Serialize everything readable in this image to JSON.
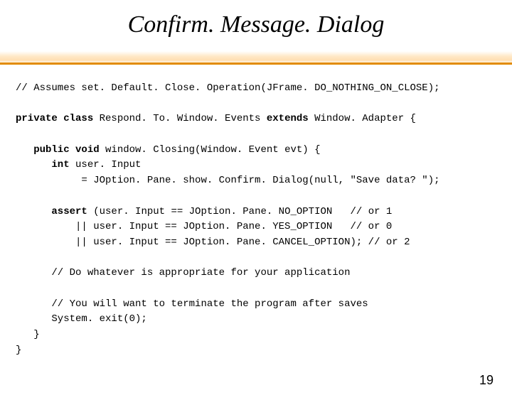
{
  "title": "Confirm. Message. Dialog",
  "code": {
    "l1a": "// Assumes set. Default. Close. Operation(JFrame. DO_NOTHING_ON_CLOSE);",
    "l2a": "private class",
    "l2b": " Respond. To. Window. Events ",
    "l2c": "extends",
    "l2d": " Window. Adapter {",
    "l3a": "   public void",
    "l3b": " window. Closing(Window. Event evt) {",
    "l4a": "      int",
    "l4b": " user. Input",
    "l5": "           = JOption. Pane. show. Confirm. Dialog(null, \"Save data? \");",
    "l6a": "      assert",
    "l6b": " (user. Input == JOption. Pane. NO_OPTION   // or 1",
    "l7": "          || user. Input == JOption. Pane. YES_OPTION   // or 0",
    "l8": "          || user. Input == JOption. Pane. CANCEL_OPTION); // or 2",
    "l9": "      // Do whatever is appropriate for your application",
    "l10": "      // You will want to terminate the program after saves",
    "l11": "      System. exit(0);",
    "l12": "   }",
    "l13": "}"
  },
  "page_number": "19"
}
